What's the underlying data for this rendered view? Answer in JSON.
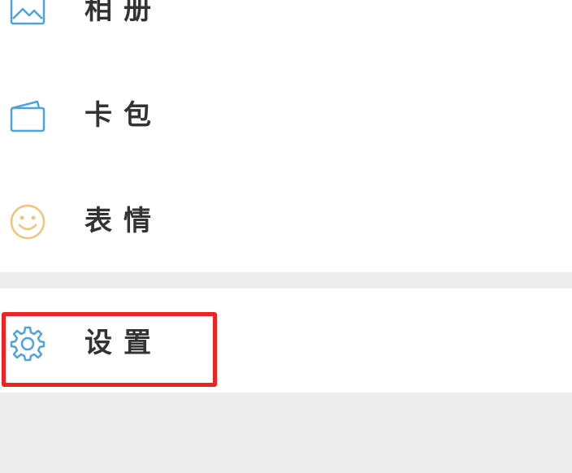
{
  "menu": {
    "items": [
      {
        "label": "相册",
        "icon": "photo-album-icon"
      },
      {
        "label": "卡包",
        "icon": "card-wallet-icon"
      },
      {
        "label": "表情",
        "icon": "smiley-face-icon"
      },
      {
        "label": "设置",
        "icon": "gear-icon"
      }
    ]
  },
  "colors": {
    "icon_blue": "#4da3e0",
    "icon_yellow": "#f3c37a",
    "highlight": "#ee2222",
    "background": "#ededed",
    "panel": "#ffffff",
    "text": "#333333"
  }
}
